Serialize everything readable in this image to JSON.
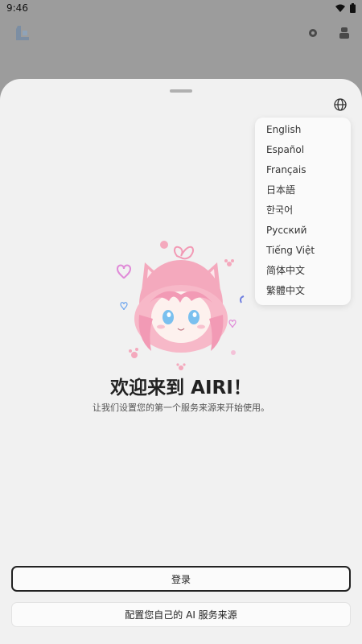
{
  "status_bar": {
    "time": "9:46",
    "icons": [
      "wifi-icon",
      "battery-icon"
    ]
  },
  "app_bar": {
    "logo": "app-logo-icon",
    "actions": [
      "gear-icon",
      "more-icon"
    ]
  },
  "language_menu": {
    "trigger_icon": "globe-icon",
    "items": [
      {
        "label": "English"
      },
      {
        "label": "Español"
      },
      {
        "label": "Français"
      },
      {
        "label": "日本語"
      },
      {
        "label": "한국어"
      },
      {
        "label": "Русский"
      },
      {
        "label": "Tiếng Việt"
      },
      {
        "label": "简体中文"
      },
      {
        "label": "繁體中文"
      }
    ]
  },
  "welcome": {
    "title": "欢迎来到 AIRI！",
    "subtitle": "让我们设置您的第一个服务来源来开始使用。"
  },
  "buttons": {
    "login": "登录",
    "config": "配置您自己的 AI 服务来源"
  },
  "colors": {
    "overlay": "#9c9c9c",
    "sheet": "#f1f1f1",
    "mascot_pink": "#f4a9bd",
    "text_dark": "#222222"
  }
}
